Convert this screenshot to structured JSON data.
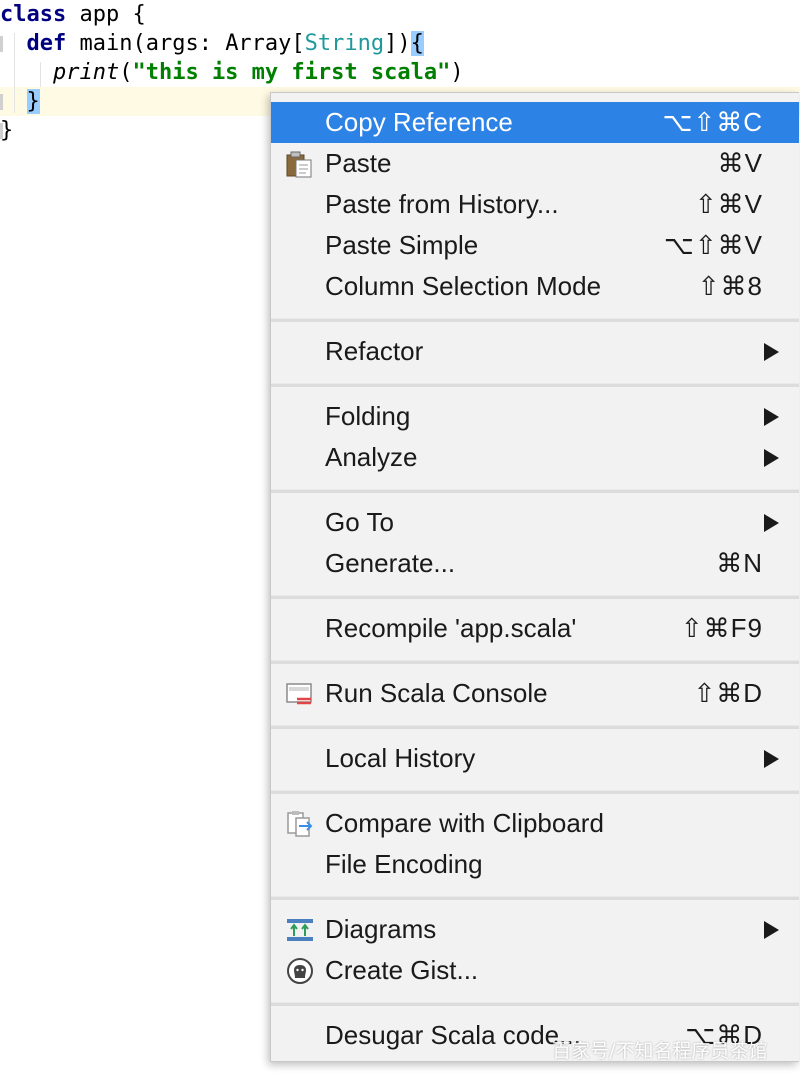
{
  "editor": {
    "line1": {
      "kw": "class",
      "rest": " app {"
    },
    "line2": {
      "indent": "  ",
      "kw": "def",
      "rest": " main(args: Array[",
      "type": "String",
      "close": "])",
      "brace": "{"
    },
    "line3": {
      "indent": "    ",
      "fn": "print",
      "open": "(",
      "str": "\"this is my first scala\"",
      "close": ")"
    },
    "line4": {
      "indent": "  ",
      "brace": "}"
    },
    "line5": {
      "text": "}"
    }
  },
  "menu": {
    "items": [
      {
        "label": "Copy Reference",
        "shortcut": "⌥⇧⌘C",
        "active": true
      },
      {
        "label": "Paste",
        "shortcut": "⌘V",
        "icon": "clipboard-paste-icon"
      },
      {
        "label": "Paste from History...",
        "shortcut": "⇧⌘V"
      },
      {
        "label": "Paste Simple",
        "shortcut": "⌥⇧⌘V"
      },
      {
        "label": "Column Selection Mode",
        "shortcut": "⇧⌘8"
      },
      {
        "label": "Refactor",
        "submenu": true
      },
      {
        "label": "Folding",
        "submenu": true
      },
      {
        "label": "Analyze",
        "submenu": true
      },
      {
        "label": "Go To",
        "submenu": true
      },
      {
        "label": "Generate...",
        "shortcut": "⌘N"
      },
      {
        "label": "Recompile 'app.scala'",
        "shortcut": "⇧⌘F9"
      },
      {
        "label": "Run Scala Console",
        "shortcut": "⇧⌘D",
        "icon": "scala-console-icon"
      },
      {
        "label": "Local History",
        "submenu": true
      },
      {
        "label": "Compare with Clipboard",
        "icon": "compare-clipboard-icon"
      },
      {
        "label": "File Encoding"
      },
      {
        "label": "Diagrams",
        "submenu": true,
        "icon": "diagrams-icon"
      },
      {
        "label": "Create Gist...",
        "icon": "github-icon"
      },
      {
        "label": "Desugar Scala code...",
        "shortcut": "⌥⌘D"
      }
    ]
  },
  "watermark": "百家号/不知名程序员茶馆",
  "colors": {
    "menu_highlight": "#2d82e6",
    "keyword": "#000080",
    "string": "#008000",
    "type": "#20999d",
    "brace_highlight": "#99ccff"
  }
}
